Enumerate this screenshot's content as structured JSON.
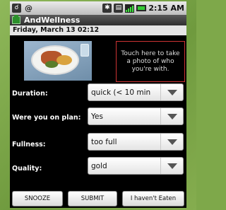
{
  "status_bar": {
    "left_icons": [
      "usb-debug-icon",
      "at-icon"
    ],
    "right_icons": [
      "bluetooth-icon",
      "sd-card-icon",
      "signal-icon",
      "battery-icon"
    ],
    "time": "2:15 AM"
  },
  "app": {
    "title": "AndWellness"
  },
  "header": {
    "date": "Friday, March 13 02:12"
  },
  "photo": {
    "prompt": "Touch here to take a photo of who you're with."
  },
  "form": {
    "duration": {
      "label": "Duration:",
      "value": "quick (< 10 min"
    },
    "on_plan": {
      "label": "Were you on plan:",
      "value": "Yes"
    },
    "fullness": {
      "label": "Fullness:",
      "value": "too full"
    },
    "quality": {
      "label": "Quality:",
      "value": "gold"
    }
  },
  "buttons": {
    "snooze": "SNOOZE",
    "submit": "SUBMIT",
    "not_eaten": "I haven't Eaten"
  },
  "colors": {
    "background_green": "#7ea84a",
    "screen": "#000000",
    "battery": "#33cc33",
    "photo_border": "#cc3333"
  }
}
